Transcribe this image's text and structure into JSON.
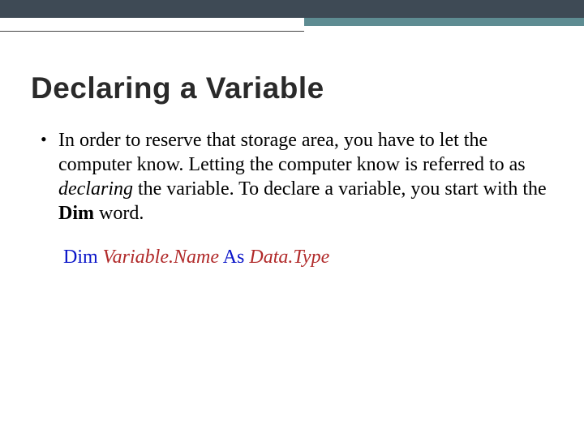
{
  "title": "Declaring a Variable",
  "body": {
    "p1": "In order to reserve that storage area, you have to let the computer know. Letting the computer know is referred to as ",
    "declaring": "declaring",
    "p2": " the variable. To declare a variable, you start with the ",
    "dim_bold": "Dim",
    "p3": " word."
  },
  "syntax": {
    "kw_dim": "Dim",
    "arg_varname": "Variable.Name",
    "kw_as": "As",
    "arg_datatype": "Data.Type"
  }
}
